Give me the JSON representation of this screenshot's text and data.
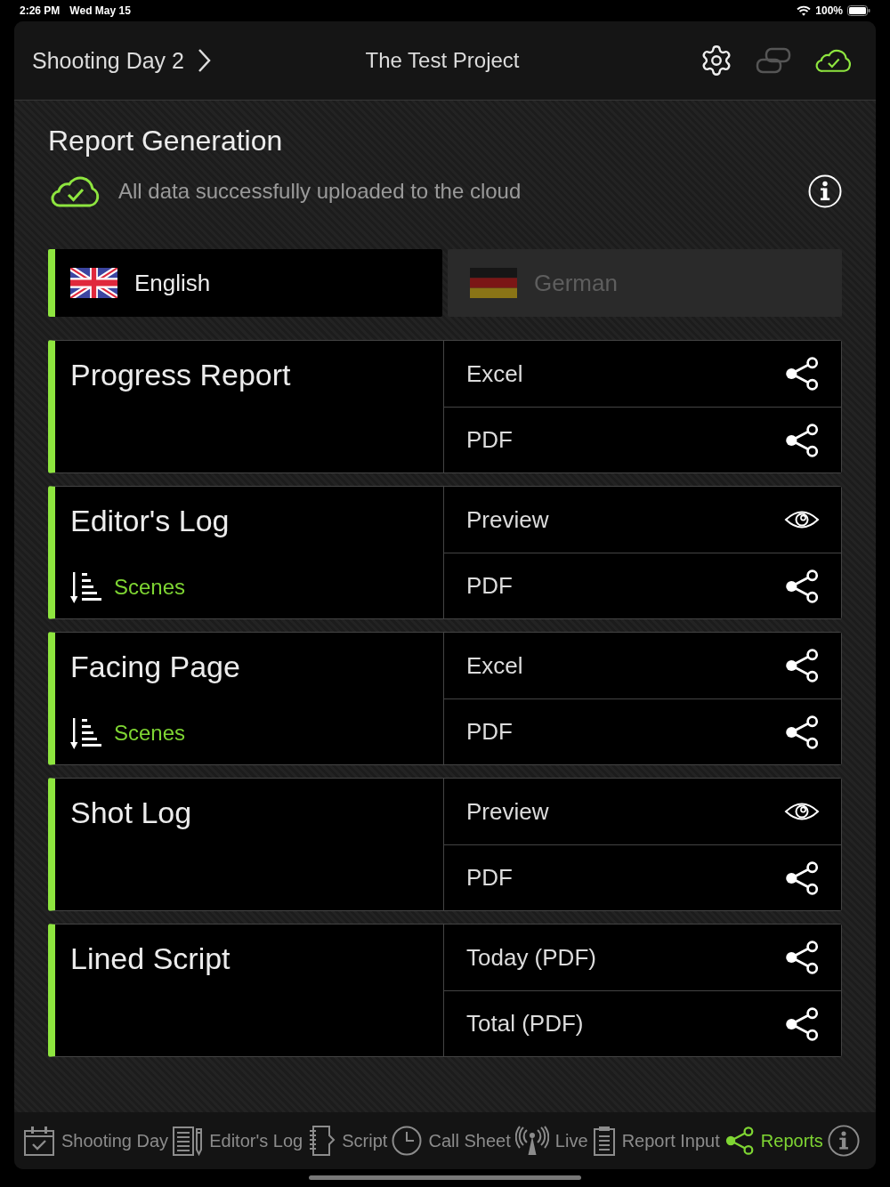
{
  "status_bar": {
    "time": "2:26 PM",
    "date": "Wed May 15",
    "battery": "100%"
  },
  "header": {
    "breadcrumb": "Shooting Day 2",
    "title": "The Test Project"
  },
  "report_generation": {
    "title": "Report Generation",
    "upload_status": "All data successfully uploaded to the cloud"
  },
  "languages": [
    {
      "label": "English",
      "kind": "uk",
      "selected": true
    },
    {
      "label": "German",
      "kind": "de",
      "selected": false
    }
  ],
  "reports": [
    {
      "title": "Progress Report",
      "outputs": [
        {
          "label": "Excel",
          "kind": "share"
        },
        {
          "label": "PDF",
          "kind": "share"
        }
      ]
    },
    {
      "title": "Editor's Log",
      "sort": "Scenes",
      "outputs": [
        {
          "label": "Preview",
          "kind": "preview"
        },
        {
          "label": "PDF",
          "kind": "share"
        }
      ]
    },
    {
      "title": "Facing Page",
      "sort": "Scenes",
      "outputs": [
        {
          "label": "Excel",
          "kind": "share"
        },
        {
          "label": "PDF",
          "kind": "share"
        }
      ]
    },
    {
      "title": "Shot Log",
      "outputs": [
        {
          "label": "Preview",
          "kind": "preview"
        },
        {
          "label": "PDF",
          "kind": "share"
        }
      ]
    },
    {
      "title": "Lined Script",
      "outputs": [
        {
          "label": "Today (PDF)",
          "kind": "share"
        },
        {
          "label": "Total (PDF)",
          "kind": "share"
        }
      ]
    }
  ],
  "tab_bar": [
    {
      "label": "Shooting Day",
      "kind": "calendar",
      "selected": false
    },
    {
      "label": "Editor's Log",
      "kind": "editor_log",
      "selected": false
    },
    {
      "label": "Script",
      "kind": "script",
      "selected": false
    },
    {
      "label": "Call Sheet",
      "kind": "call_sheet",
      "selected": false
    },
    {
      "label": "Live",
      "kind": "live",
      "selected": false
    },
    {
      "label": "Report Input",
      "kind": "report_input",
      "selected": false
    },
    {
      "label": "Reports",
      "kind": "reports",
      "selected": true
    }
  ]
}
